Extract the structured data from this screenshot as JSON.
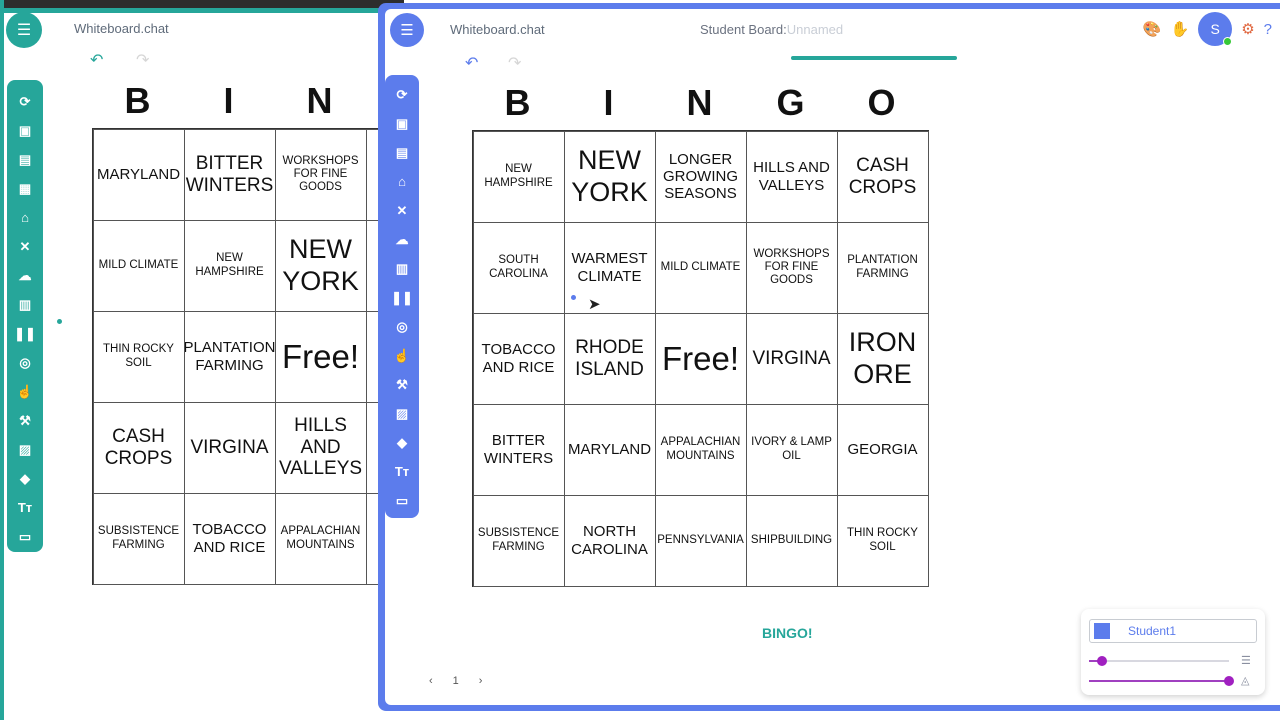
{
  "app": {
    "title": "Whiteboard.chat"
  },
  "back_window": {
    "title": "Whiteboard.chat",
    "undo_icon": "undo-icon",
    "redo_icon": "redo-icon",
    "toolbar": [
      "refresh-icon",
      "save-icon",
      "images-icon",
      "grid-icon",
      "home-icon",
      "close-icon",
      "cloud-upload-icon",
      "book-icon",
      "pause-icon",
      "touch-icon",
      "hand-icon",
      "wrench-icon",
      "image-icon",
      "eraser-icon",
      "text-icon",
      "screen-icon"
    ],
    "letters": [
      "B",
      "I",
      "N"
    ],
    "cells": [
      [
        "MARYLAND",
        "BITTER WINTERS",
        "WORKSHOPS FOR FINE GOODS"
      ],
      [
        "MILD CLIMATE",
        "NEW HAMPSHIRE",
        "NEW YORK"
      ],
      [
        "THIN ROCKY SOIL",
        "PLANTATION FARMING",
        "Free!"
      ],
      [
        "CASH CROPS",
        "VIRGINA",
        "HILLS AND VALLEYS"
      ],
      [
        "SUBSISTENCE FARMING",
        "TOBACCO AND RICE",
        "APPALACHIAN MOUNTAINS"
      ]
    ]
  },
  "front_window": {
    "title": "Whiteboard.chat",
    "student_board_label": "Student Board:",
    "student_board_name": "Unnamed",
    "toolbar": [
      "refresh-icon",
      "save-icon",
      "images-icon",
      "home-icon",
      "close-icon",
      "cloud-upload-icon",
      "book-icon",
      "pause-icon",
      "touch-icon",
      "hand-icon",
      "wrench-icon",
      "image-icon",
      "eraser-icon",
      "text-icon",
      "screen-icon"
    ],
    "top_icons": [
      "palette-icon",
      "raise-hand-icon"
    ],
    "avatar_letter": "S",
    "letters": [
      "B",
      "I",
      "N",
      "G",
      "O"
    ],
    "cells": [
      [
        "NEW HAMPSHIRE",
        "NEW YORK",
        "LONGER GROWING SEASONS",
        "HILLS AND VALLEYS",
        "CASH CROPS"
      ],
      [
        "SOUTH CAROLINA",
        "WARMEST CLIMATE",
        "MILD CLIMATE",
        "WORKSHOPS FOR FINE GOODS",
        "PLANTATION FARMING"
      ],
      [
        "TOBACCO AND RICE",
        "RHODE ISLAND",
        "Free!",
        "VIRGINA",
        "IRON ORE"
      ],
      [
        "BITTER WINTERS",
        "MARYLAND",
        "APPALACHIAN MOUNTAINS",
        "IVORY & LAMP OIL",
        "GEORGIA"
      ],
      [
        "SUBSISTENCE FARMING",
        "NORTH CAROLINA",
        "PENNSYLVANIA",
        "SHIPBUILDING",
        "THIN ROCKY SOIL"
      ]
    ],
    "bingo_button": "BINGO!",
    "page_number": "1",
    "student_panel": {
      "name": "Student1",
      "size_slider": 0.09,
      "opacity_slider": 1.0
    }
  },
  "colors": {
    "teal": "#26a69a",
    "blue": "#5c7cec",
    "purple": "#a020c0",
    "orange": "#e0673f"
  }
}
